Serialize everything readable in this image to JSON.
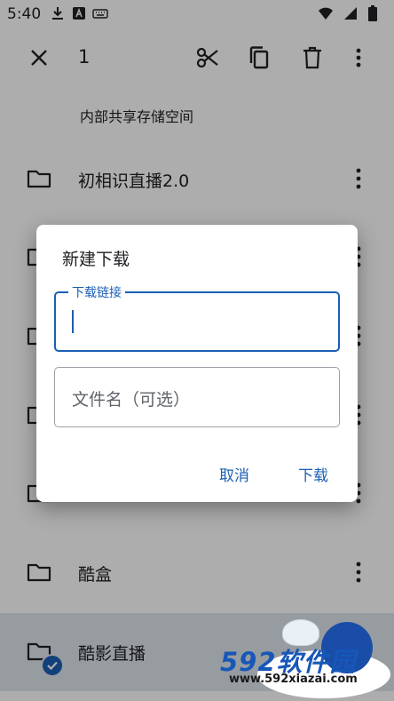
{
  "status_bar": {
    "time": "5:40",
    "icons": [
      "download-icon",
      "text-a-icon",
      "keyboard-icon",
      "wifi-icon",
      "signal-icon",
      "battery-icon"
    ]
  },
  "toolbar": {
    "selection_count": "1",
    "actions": [
      "close-icon",
      "cut-icon",
      "copy-icon",
      "delete-icon",
      "more-vert-icon"
    ]
  },
  "breadcrumb": {
    "path": "内部共享存储空间"
  },
  "file_list": [
    {
      "name": "初相识直播2.0",
      "selected": false
    },
    {
      "name": "",
      "selected": false
    },
    {
      "name": "",
      "selected": false
    },
    {
      "name": "",
      "selected": false
    },
    {
      "name": "",
      "selected": false
    },
    {
      "name": "酷盒",
      "selected": false
    },
    {
      "name": "酷影直播",
      "selected": true
    }
  ],
  "dialog": {
    "title": "新建下载",
    "url_field": {
      "label": "下载链接",
      "value": ""
    },
    "filename_field": {
      "placeholder": "文件名（可选）",
      "value": ""
    },
    "cancel_label": "取消",
    "confirm_label": "下载"
  },
  "watermark": {
    "brand": "592软件园",
    "url": "www.592xiazai.com"
  },
  "colors": {
    "accent": "#1a5fb4",
    "scrim": "rgba(0,0,0,0.32)",
    "selected_row": "#dfe6ee"
  }
}
